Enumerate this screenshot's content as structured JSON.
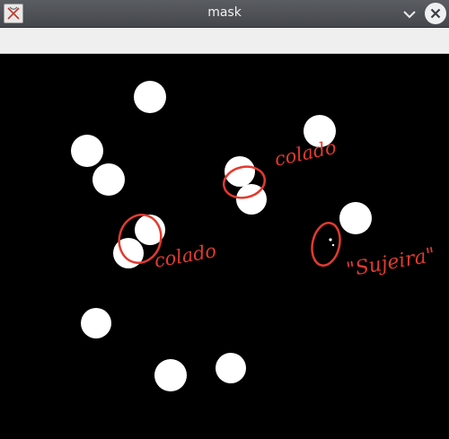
{
  "window": {
    "title": "mask",
    "app_icon": "x-app-icon",
    "controls": [
      "minimize-chevron-icon",
      "close-circle-icon"
    ]
  },
  "canvas": {
    "background": "#000000",
    "blob_color": "#ffffff",
    "annotation_color": "#e23a2e",
    "annotations": {
      "colado_right": "colado",
      "colado_left": "colado",
      "sujeira": "\"Sujeira\""
    }
  }
}
